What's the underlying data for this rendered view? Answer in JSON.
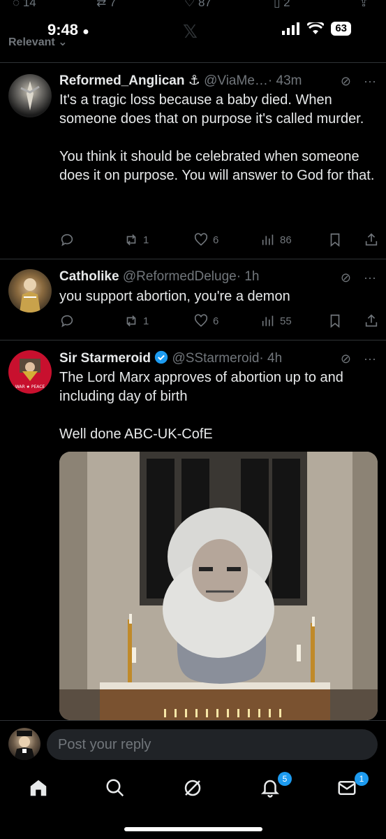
{
  "header_stats": {
    "replies": "14",
    "retweets": "7",
    "likes": "87",
    "bookmarks": "2"
  },
  "status_bar": {
    "time": "9:48",
    "battery": "63"
  },
  "sort_label": "Relevant",
  "tweets": [
    {
      "display_name": "Reformed_Anglican",
      "name_emoji": "⚓",
      "handle": "@ViaMe…",
      "time": "· 43m",
      "paragraphs": [
        "It's a tragic loss because a baby died. When someone does that on purpose it's called murder.",
        "You think it should be celebrated when someone does it on purpose. You will answer to God for that."
      ],
      "retweets": "1",
      "likes": "6",
      "views": "86"
    },
    {
      "display_name": "Catholike",
      "handle": "@ReformedDeluge",
      "time": "· 1h",
      "paragraphs": [
        "you support abortion, you're a demon"
      ],
      "retweets": "1",
      "likes": "6",
      "views": "55"
    },
    {
      "display_name": "Sir Starmeroid",
      "handle": "@SStarmeroid",
      "time": "· 4h",
      "paragraphs": [
        "The Lord Marx approves of abortion up to and including day of birth",
        "Well done ABC-UK-CofE"
      ],
      "avatar_text": "WAR ★ PEACE"
    }
  ],
  "reply": {
    "placeholder": "Post your reply"
  },
  "tabbar": {
    "notifications_badge": "5",
    "messages_badge": "1"
  },
  "colors": {
    "accent": "#1d9bf0",
    "muted": "#71767b",
    "background": "#000000"
  }
}
